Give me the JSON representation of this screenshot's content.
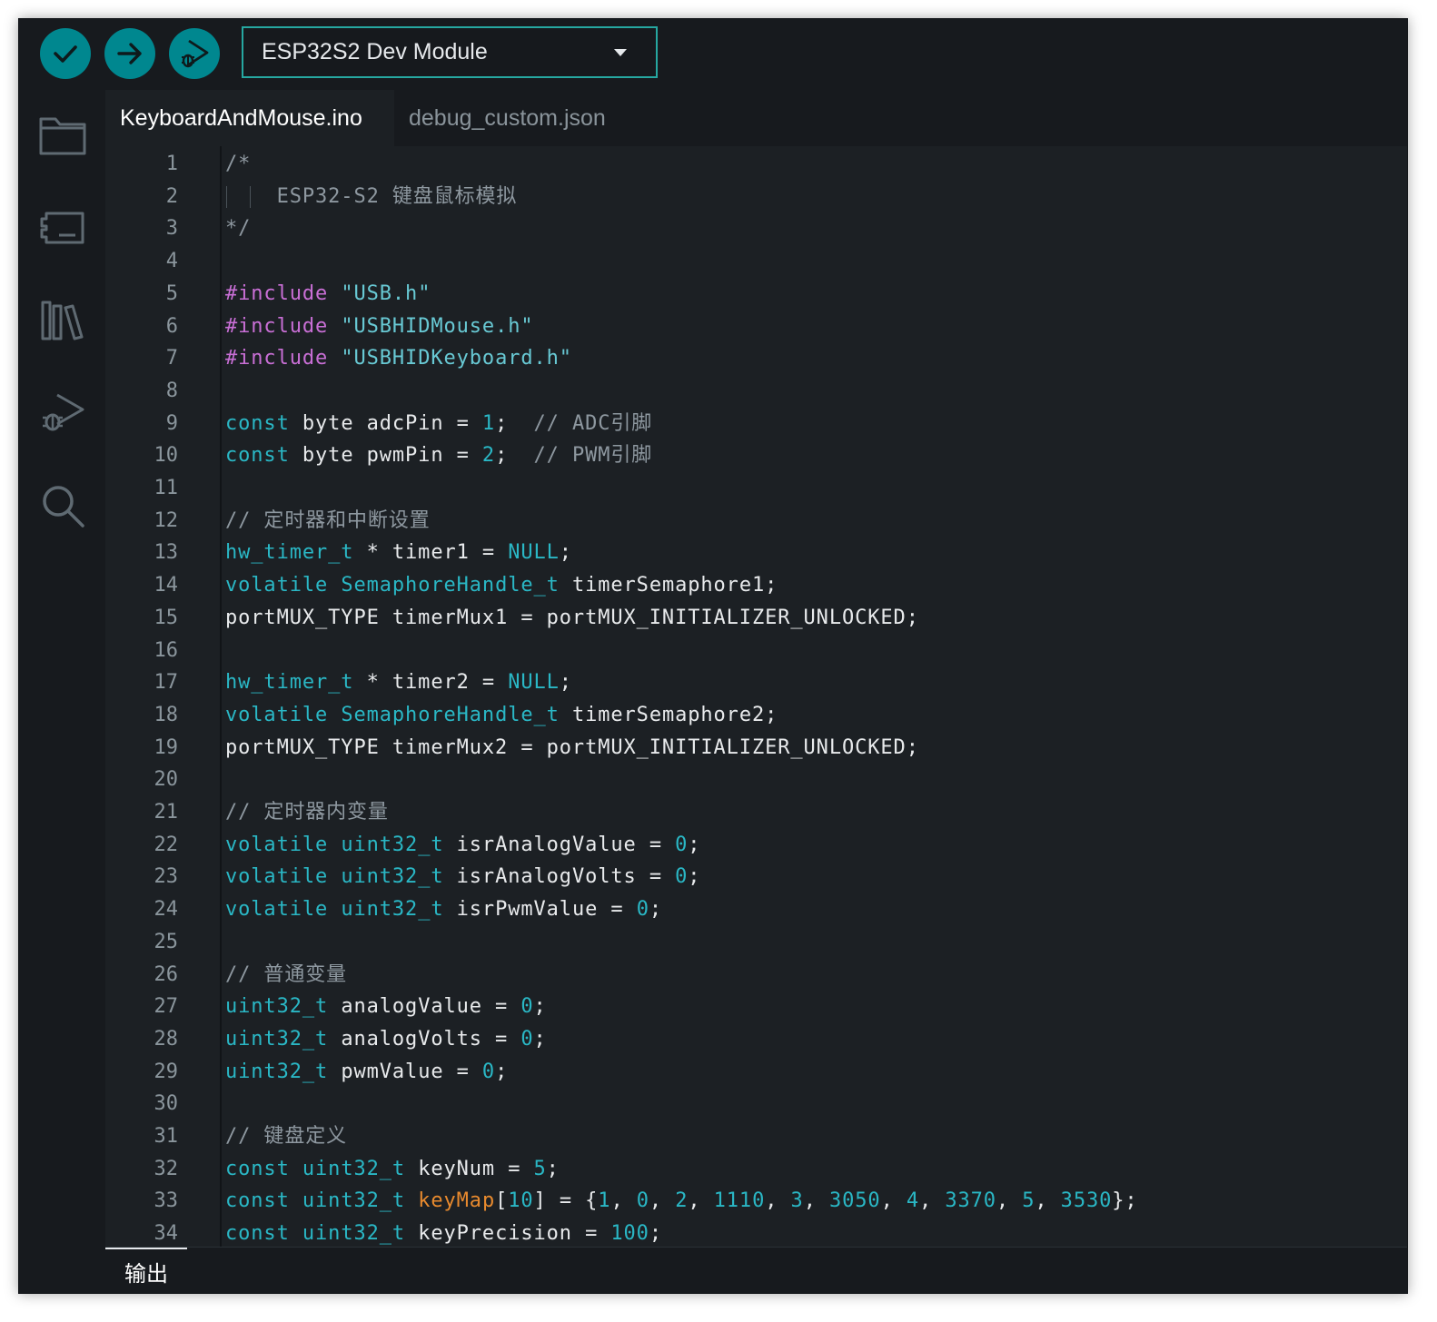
{
  "toolbar": {
    "verify_icon": "check-icon",
    "upload_icon": "arrow-right-icon",
    "debug_icon": "debug-icon",
    "board_select": {
      "value": "ESP32S2 Dev Module",
      "icon": "caret-down-icon"
    }
  },
  "sidebar": {
    "items": [
      {
        "icon": "folder-icon"
      },
      {
        "icon": "board-manager-icon"
      },
      {
        "icon": "library-icon"
      },
      {
        "icon": "debug-icon"
      },
      {
        "icon": "search-icon"
      }
    ]
  },
  "tabs": [
    {
      "label": "KeyboardAndMouse.ino",
      "active": true
    },
    {
      "label": "debug_custom.json",
      "active": false
    }
  ],
  "editor": {
    "lines": [
      {
        "n": "1",
        "tokens": [
          [
            "cm",
            "/*"
          ]
        ]
      },
      {
        "n": "2",
        "indent": true,
        "tokens": [
          [
            "cm",
            "    ESP32-S2 键盘鼠标模拟"
          ]
        ]
      },
      {
        "n": "3",
        "tokens": [
          [
            "cm",
            "*/"
          ]
        ]
      },
      {
        "n": "4",
        "tokens": []
      },
      {
        "n": "5",
        "tokens": [
          [
            "pp",
            "#include"
          ],
          [
            "pl",
            " "
          ],
          [
            "str",
            "\"USB.h\""
          ]
        ]
      },
      {
        "n": "6",
        "tokens": [
          [
            "pp",
            "#include"
          ],
          [
            "pl",
            " "
          ],
          [
            "str",
            "\"USBHIDMouse.h\""
          ]
        ]
      },
      {
        "n": "7",
        "tokens": [
          [
            "pp",
            "#include"
          ],
          [
            "pl",
            " "
          ],
          [
            "str",
            "\"USBHIDKeyboard.h\""
          ]
        ]
      },
      {
        "n": "8",
        "tokens": []
      },
      {
        "n": "9",
        "tokens": [
          [
            "kw",
            "const"
          ],
          [
            "pl",
            " byte adcPin = "
          ],
          [
            "num",
            "1"
          ],
          [
            "pl",
            ";  "
          ],
          [
            "cm",
            "// ADC引脚"
          ]
        ]
      },
      {
        "n": "10",
        "tokens": [
          [
            "kw",
            "const"
          ],
          [
            "pl",
            " byte pwmPin = "
          ],
          [
            "num",
            "2"
          ],
          [
            "pl",
            ";  "
          ],
          [
            "cm",
            "// PWM引脚"
          ]
        ]
      },
      {
        "n": "11",
        "tokens": []
      },
      {
        "n": "12",
        "tokens": [
          [
            "cm",
            "// 定时器和中断设置"
          ]
        ]
      },
      {
        "n": "13",
        "tokens": [
          [
            "kw",
            "hw_timer_t"
          ],
          [
            "pl",
            " * timer1 = "
          ],
          [
            "kw",
            "NULL"
          ],
          [
            "pl",
            ";"
          ]
        ]
      },
      {
        "n": "14",
        "tokens": [
          [
            "kw",
            "volatile"
          ],
          [
            "pl",
            " "
          ],
          [
            "kw",
            "SemaphoreHandle_t"
          ],
          [
            "pl",
            " timerSemaphore1;"
          ]
        ]
      },
      {
        "n": "15",
        "tokens": [
          [
            "pl",
            "portMUX_TYPE timerMux1 = portMUX_INITIALIZER_UNLOCKED;"
          ]
        ]
      },
      {
        "n": "16",
        "tokens": []
      },
      {
        "n": "17",
        "tokens": [
          [
            "kw",
            "hw_timer_t"
          ],
          [
            "pl",
            " * timer2 = "
          ],
          [
            "kw",
            "NULL"
          ],
          [
            "pl",
            ";"
          ]
        ]
      },
      {
        "n": "18",
        "tokens": [
          [
            "kw",
            "volatile"
          ],
          [
            "pl",
            " "
          ],
          [
            "kw",
            "SemaphoreHandle_t"
          ],
          [
            "pl",
            " timerSemaphore2;"
          ]
        ]
      },
      {
        "n": "19",
        "tokens": [
          [
            "pl",
            "portMUX_TYPE timerMux2 = portMUX_INITIALIZER_UNLOCKED;"
          ]
        ]
      },
      {
        "n": "20",
        "tokens": []
      },
      {
        "n": "21",
        "tokens": [
          [
            "cm",
            "// 定时器内变量"
          ]
        ]
      },
      {
        "n": "22",
        "tokens": [
          [
            "kw",
            "volatile"
          ],
          [
            "pl",
            " "
          ],
          [
            "kw",
            "uint32_t"
          ],
          [
            "pl",
            " isrAnalogValue = "
          ],
          [
            "num",
            "0"
          ],
          [
            "pl",
            ";"
          ]
        ]
      },
      {
        "n": "23",
        "tokens": [
          [
            "kw",
            "volatile"
          ],
          [
            "pl",
            " "
          ],
          [
            "kw",
            "uint32_t"
          ],
          [
            "pl",
            " isrAnalogVolts = "
          ],
          [
            "num",
            "0"
          ],
          [
            "pl",
            ";"
          ]
        ]
      },
      {
        "n": "24",
        "tokens": [
          [
            "kw",
            "volatile"
          ],
          [
            "pl",
            " "
          ],
          [
            "kw",
            "uint32_t"
          ],
          [
            "pl",
            " isrPwmValue = "
          ],
          [
            "num",
            "0"
          ],
          [
            "pl",
            ";"
          ]
        ]
      },
      {
        "n": "25",
        "tokens": []
      },
      {
        "n": "26",
        "tokens": [
          [
            "cm",
            "// 普通变量"
          ]
        ]
      },
      {
        "n": "27",
        "tokens": [
          [
            "kw",
            "uint32_t"
          ],
          [
            "pl",
            " analogValue = "
          ],
          [
            "num",
            "0"
          ],
          [
            "pl",
            ";"
          ]
        ]
      },
      {
        "n": "28",
        "tokens": [
          [
            "kw",
            "uint32_t"
          ],
          [
            "pl",
            " analogVolts = "
          ],
          [
            "num",
            "0"
          ],
          [
            "pl",
            ";"
          ]
        ]
      },
      {
        "n": "29",
        "tokens": [
          [
            "kw",
            "uint32_t"
          ],
          [
            "pl",
            " pwmValue = "
          ],
          [
            "num",
            "0"
          ],
          [
            "pl",
            ";"
          ]
        ]
      },
      {
        "n": "30",
        "tokens": []
      },
      {
        "n": "31",
        "tokens": [
          [
            "cm",
            "// 键盘定义"
          ]
        ]
      },
      {
        "n": "32",
        "tokens": [
          [
            "kw",
            "const"
          ],
          [
            "pl",
            " "
          ],
          [
            "kw",
            "uint32_t"
          ],
          [
            "pl",
            " keyNum = "
          ],
          [
            "num",
            "5"
          ],
          [
            "pl",
            ";"
          ]
        ]
      },
      {
        "n": "33",
        "tokens": [
          [
            "kw",
            "const"
          ],
          [
            "pl",
            " "
          ],
          [
            "kw",
            "uint32_t"
          ],
          [
            "pl",
            " "
          ],
          [
            "fn",
            "keyMap"
          ],
          [
            "pl",
            "["
          ],
          [
            "num",
            "10"
          ],
          [
            "pl",
            "] = {"
          ],
          [
            "num",
            "1"
          ],
          [
            "pl",
            ", "
          ],
          [
            "num",
            "0"
          ],
          [
            "pl",
            ", "
          ],
          [
            "num",
            "2"
          ],
          [
            "pl",
            ", "
          ],
          [
            "num",
            "1110"
          ],
          [
            "pl",
            ", "
          ],
          [
            "num",
            "3"
          ],
          [
            "pl",
            ", "
          ],
          [
            "num",
            "3050"
          ],
          [
            "pl",
            ", "
          ],
          [
            "num",
            "4"
          ],
          [
            "pl",
            ", "
          ],
          [
            "num",
            "3370"
          ],
          [
            "pl",
            ", "
          ],
          [
            "num",
            "5"
          ],
          [
            "pl",
            ", "
          ],
          [
            "num",
            "3530"
          ],
          [
            "pl",
            "};"
          ]
        ]
      },
      {
        "n": "34",
        "tokens": [
          [
            "kw",
            "const"
          ],
          [
            "pl",
            " "
          ],
          [
            "kw",
            "uint32_t"
          ],
          [
            "pl",
            " keyPrecision = "
          ],
          [
            "num",
            "100"
          ],
          [
            "pl",
            ";"
          ]
        ]
      }
    ]
  },
  "output": {
    "tab_label": "输出"
  }
}
